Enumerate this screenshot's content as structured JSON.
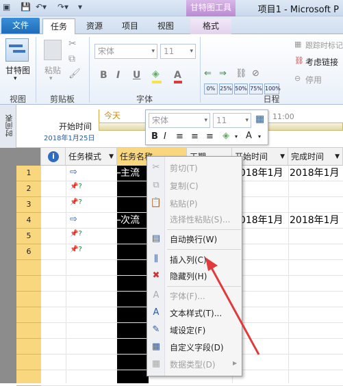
{
  "titlebar": {
    "app_title": "项目1 - Microsoft P",
    "context_header": "甘特图工具"
  },
  "tabs": {
    "file": "文件",
    "task": "任务",
    "resource": "资源",
    "project": "项目",
    "view": "视图",
    "format": "格式"
  },
  "ribbon": {
    "view_group": {
      "gantt_label": "甘特图",
      "label": "视图"
    },
    "clipboard_group": {
      "paste_label": "粘贴",
      "label": "剪贴板"
    },
    "font_group": {
      "font_name": "宋体",
      "font_size": "11",
      "label": "字体"
    },
    "schedule_group": {
      "percent_buttons": [
        "0%",
        "25%",
        "50%",
        "75%",
        "100%"
      ],
      "track_label": "跟踪时标记",
      "respect_links_label": "考虑链接",
      "inactivate_label": "停用",
      "label": "日程"
    }
  },
  "timeline": {
    "side_label": "时间表",
    "today_label": "今天",
    "start_label": "开始时间",
    "start_date": "2018年1月25日",
    "time_tick": "11:00"
  },
  "mini_toolbar": {
    "font_name": "宋体",
    "font_size": "11"
  },
  "grid": {
    "columns": {
      "info": "",
      "task_mode": "任务模式",
      "task_name": "任务名称",
      "duration": "工期",
      "start": "开始时间",
      "finish": "完成时间"
    },
    "rows": [
      {
        "num": "1",
        "mode": "auto",
        "name": "主流",
        "start": "2018年1月",
        "finish": "2018年1月"
      },
      {
        "num": "2",
        "mode": "manual",
        "name": "",
        "start": "",
        "finish": ""
      },
      {
        "num": "3",
        "mode": "manual",
        "name": "",
        "start": "",
        "finish": ""
      },
      {
        "num": "4",
        "mode": "auto",
        "name": "次流",
        "start": "2018年1月",
        "finish": "2018年1月"
      },
      {
        "num": "5",
        "mode": "manual",
        "name": "",
        "start": "",
        "finish": ""
      },
      {
        "num": "6",
        "mode": "manual",
        "name": "",
        "start": "",
        "finish": ""
      }
    ]
  },
  "context_menu": {
    "cut": "剪切(T)",
    "copy": "复制(C)",
    "paste": "粘贴(P)",
    "paste_special": "选择性粘贴(S)...",
    "wrap_text": "自动换行(W)",
    "insert_column": "插入列(C)",
    "hide_column": "隐藏列(H)",
    "font": "字体(F)...",
    "text_styles": "文本样式(T)...",
    "field_settings": "域设定(F)",
    "custom_fields": "自定义字段(D)",
    "data_type": "数据类型(D)"
  },
  "colors": {
    "accent_red": "#e03a3a",
    "context_purple": "#b98ad1",
    "row_header": "#f8d77e"
  }
}
